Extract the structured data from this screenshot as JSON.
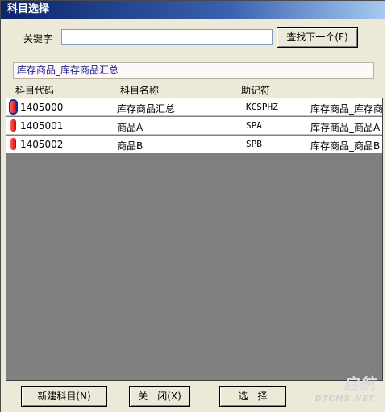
{
  "window": {
    "title": "科目选择"
  },
  "search": {
    "label": "关键字",
    "value": "",
    "find_next_label": "查找下一个(F)"
  },
  "path": {
    "text": "库存商品_库存商品汇总"
  },
  "columns": [
    "科目代码",
    "科目名称",
    "助记符"
  ],
  "rows": [
    {
      "code": "1405000",
      "name": "库存商品汇总",
      "mnemonic": "KCSPHZ",
      "full": "库存商品_库存商"
    },
    {
      "code": "1405001",
      "name": "商品A",
      "mnemonic": "SPA",
      "full": "库存商品_商品A"
    },
    {
      "code": "1405002",
      "name": "商品B",
      "mnemonic": "SPB",
      "full": "库存商品_商品B"
    }
  ],
  "buttons": {
    "new_label": "新建科目(N)",
    "close_label": "关　闭(X)",
    "select_label": "选　择"
  },
  "watermark": {
    "brand": "启航",
    "site": "DTCMS.NET"
  },
  "colors": {
    "title_start": "#0a246a",
    "flag": "#e00000",
    "grid_bg": "#808080"
  }
}
